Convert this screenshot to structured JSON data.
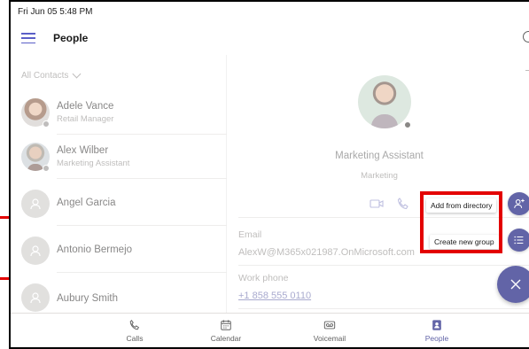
{
  "status": {
    "datetime": "Fri Jun 05  5:48 PM"
  },
  "header": {
    "title": "People"
  },
  "contacts": {
    "filter_label": "All Contacts",
    "items": [
      {
        "name": "Adele Vance",
        "role": "Retail Manager"
      },
      {
        "name": "Alex Wilber",
        "role": "Marketing Assistant"
      },
      {
        "name": "Angel Garcia",
        "role": ""
      },
      {
        "name": "Antonio Bermejo",
        "role": ""
      },
      {
        "name": "Aubury Smith",
        "role": ""
      }
    ]
  },
  "detail": {
    "role": "Marketing Assistant",
    "department": "Marketing",
    "email_label": "Email",
    "email_value": "AlexW@M365x021987.OnMicrosoft.com",
    "phone_label": "Work phone",
    "phone_value": "+1 858 555 0110"
  },
  "fab_menu": {
    "add_from_directory": "Add from directory",
    "create_new_group": "Create new group"
  },
  "nav": {
    "items": [
      {
        "label": "Calls",
        "icon": "phone-icon"
      },
      {
        "label": "Calendar",
        "icon": "calendar-icon"
      },
      {
        "label": "Voicemail",
        "icon": "voicemail-icon"
      },
      {
        "label": "People",
        "icon": "people-icon"
      }
    ],
    "active": "People"
  },
  "colors": {
    "accent": "#6264a7",
    "highlight": "#e30000",
    "muted_text": "#8a8886"
  }
}
